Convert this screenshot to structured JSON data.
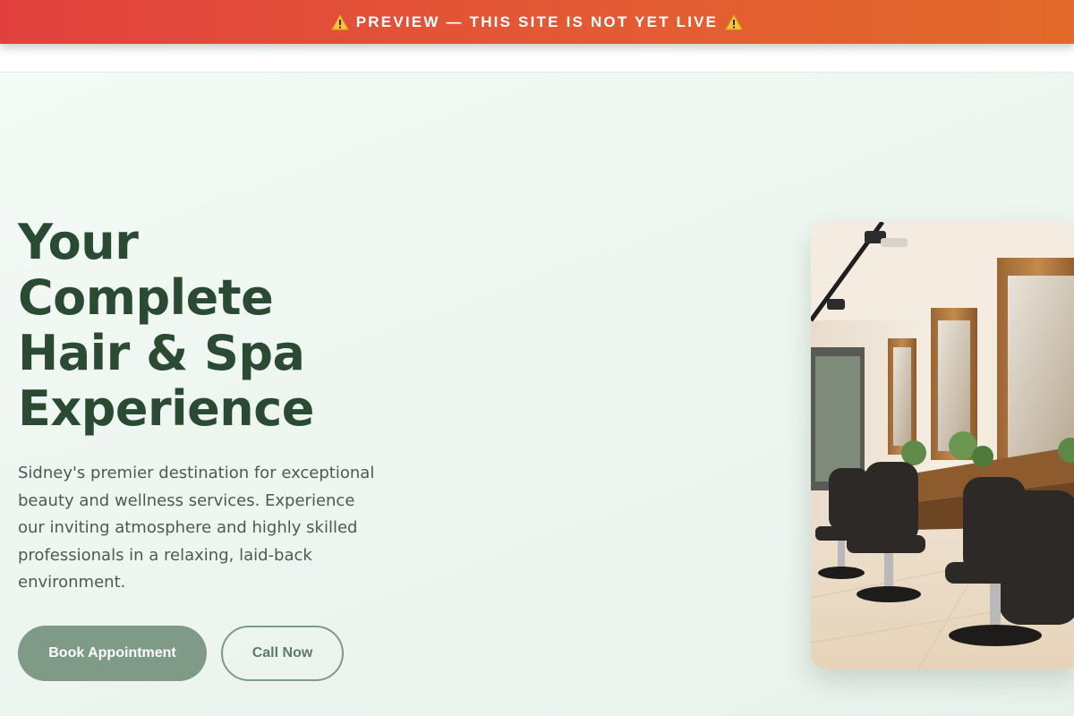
{
  "banner": {
    "text": "PREVIEW — THIS SITE IS NOT YET LIVE",
    "icon": "warning-icon"
  },
  "hero": {
    "title_lines": [
      "Your",
      "Complete",
      "Hair & Spa",
      "Experience"
    ],
    "description": "Sidney's premier destination for exceptional beauty and wellness services. Experience our inviting atmosphere and highly skilled professionals in a relaxing, laid-back environment.",
    "primary_button": "Book Appointment",
    "secondary_button": "Call Now",
    "image_subject": "salon-interior-photo"
  },
  "colors": {
    "banner_start": "#e2403e",
    "banner_end": "#e2692a",
    "title": "#2b4a33",
    "accent": "#7f9a87",
    "hero_bg": "#eef6f0"
  }
}
